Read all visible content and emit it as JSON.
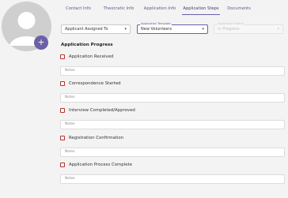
{
  "tabs": [
    {
      "label": "Contact Info"
    },
    {
      "label": "Theocratic Info"
    },
    {
      "label": "Application Info"
    },
    {
      "label": "Application Steps"
    },
    {
      "label": "Documents"
    }
  ],
  "active_tab": "Application Steps",
  "fields": {
    "assigned": {
      "value": "Applicant Assigned To"
    },
    "template": {
      "label": "Application Template",
      "value": "New Volunteers"
    },
    "status": {
      "label": "Application Status",
      "value": "In Progress"
    }
  },
  "progress": {
    "title": "Application Progress",
    "notes_placeholder": "Notes",
    "steps": [
      {
        "label": "Application Received",
        "checked": false
      },
      {
        "label": "Correspondence Started",
        "checked": false
      },
      {
        "label": "Interview Completed/Approved",
        "checked": false
      },
      {
        "label": "Registration Confirmation",
        "checked": false
      },
      {
        "label": "Application Process Complete",
        "checked": false
      }
    ]
  },
  "colors": {
    "accent": "#6b5fa7",
    "checkbox_border": "#b5302b",
    "background": "#f3f3f3"
  },
  "icons": {
    "avatar": "person-icon",
    "add": "plus-icon",
    "dropdown": "chevron-down-icon"
  }
}
